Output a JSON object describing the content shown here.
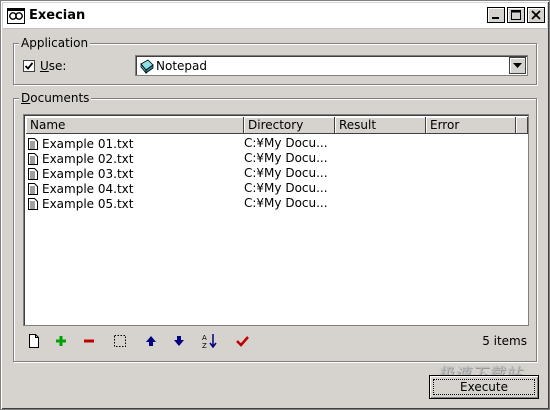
{
  "window": {
    "title": "Execian",
    "minimize_icon": "minimize-icon",
    "maximize_icon": "maximize-icon",
    "close_icon": "close-icon"
  },
  "application": {
    "group_label": "Application",
    "use_label": "Use:",
    "use_checked": true,
    "selected_app": "Notepad",
    "app_icon": "notepad-icon"
  },
  "documents": {
    "group_label": "Documents",
    "columns": [
      "Name",
      "Directory",
      "Result",
      "Error"
    ],
    "rows": [
      {
        "name": "Example 01.txt",
        "directory": "C:¥My Docu...",
        "result": "",
        "error": ""
      },
      {
        "name": "Example 02.txt",
        "directory": "C:¥My Docu...",
        "result": "",
        "error": ""
      },
      {
        "name": "Example 03.txt",
        "directory": "C:¥My Docu...",
        "result": "",
        "error": ""
      },
      {
        "name": "Example 04.txt",
        "directory": "C:¥My Docu...",
        "result": "",
        "error": ""
      },
      {
        "name": "Example 05.txt",
        "directory": "C:¥My Docu...",
        "result": "",
        "error": ""
      }
    ],
    "item_count": "5 items"
  },
  "toolbar": {
    "tools": [
      "new-document-icon",
      "add-icon",
      "remove-icon",
      "select-icon",
      "move-up-icon",
      "move-down-icon",
      "sort-az-icon",
      "check-icon"
    ]
  },
  "execute_label": "Execute",
  "watermark": "极速下载站",
  "colors": {
    "window_bg": "#d6d3ce",
    "add_green": "#00a000",
    "remove_red": "#c00000",
    "arrow_blue": "#000080",
    "check_red": "#c00000"
  }
}
